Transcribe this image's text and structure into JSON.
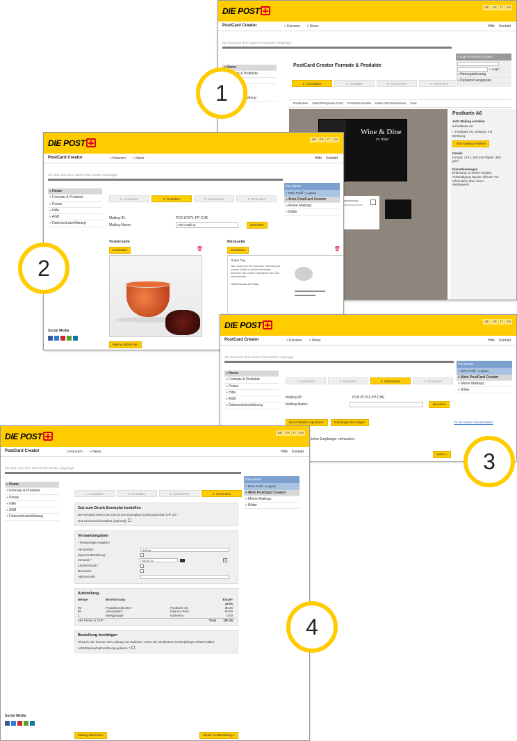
{
  "brand": {
    "logo_text": "DIE POST",
    "app_name": "PostCard Creator",
    "langs": [
      "DE",
      "FR",
      "IT",
      "EN"
    ]
  },
  "nav": {
    "konzern": "» Konzern",
    "news": "» News",
    "hilfe": "Hilfe",
    "kontakt": "Kontakt"
  },
  "badges": [
    "1",
    "2",
    "3",
    "4"
  ],
  "breadcrumb": "Sie sind unter dem Namen ihre Muster eingeloggt",
  "side": [
    "» Home",
    "» Formate & Produkte",
    "» Preise",
    "» Hilfe",
    "» AGB",
    "» Datenschutzerklärung"
  ],
  "steps": [
    "1. Auswählen",
    "2. Gestalten",
    "3. Adressieren",
    "4. Versenden"
  ],
  "right_panel": {
    "user": "Ihre Muster",
    "links": [
      "» Mein Profil",
      "» Logout"
    ],
    "items": [
      "» Mein PostCard Creator",
      "» Meine Mailings",
      "» Bilder"
    ]
  },
  "s1": {
    "title": "PostCard Creator Formate & Produkte",
    "login": "» Login PostCard Creator",
    "login_btn": "» Login",
    "reg": "» Neuregistrierung",
    "forgot": "» Passwort vergessen",
    "filters": [
      "Postkarten",
      "Direct/Response Card",
      "Postkarte Kreativ",
      "Karte mit Gutscheinen",
      "Fuer"
    ],
    "poster_title": "Wine & Dine",
    "poster_sub": "im Hotel",
    "side_item": "Postkartenbestellung",
    "product": "Postkarte A6",
    "create_head": "Jetzt Mailing erstellen",
    "opt1": "Postkarte A6",
    "opt2": "Postkarte A6, schwarz, mit Werbung",
    "btn": "Jetzt Mailing erstellen",
    "details_head": "Details",
    "details": "Format: 176 x 250 mm Papier: 300 g/m²",
    "extra_head": "Dienstleistungen",
    "extra": "Erfassung zu einem Kunden Ankündigung Tag der offenen Tür Information über einen Wettbewerb"
  },
  "s2": {
    "mailing_id_label": "Mailing-ID:",
    "mailing_id": "PCK-87271-PP-CHE",
    "mailing_name_label": "Mailing-Name:",
    "mailing_name": "Mein Mailing",
    "save": "speichern",
    "front": "Vorderseite",
    "back": "Rückseite",
    "edit": "bearbeiten",
    "greeting": "Guten Tag",
    "card_text": "Nur noch kurz ein bisschen Werbung für unsere Aktion vom Wochenende, kommen Sie vorbei und lassen Sie sich überraschen.",
    "card_sign": "Liebe Grüsse Ihr Team",
    "social": "Social Media",
    "cta": "Mailing abbrechen"
  },
  "s3": {
    "mailing_id": "PCK-87151-PP-CHE",
    "buttons": [
      "Excel-Tabelle importieren",
      "Empfänger hinzufügen"
    ],
    "link": "Zu ein Muster herunterladen",
    "empty": "keine Empfänger vorhanden.",
    "next": "weiter »"
  },
  "s4": {
    "sec1_title": "Gut zum Druck Exemplar bestellen",
    "sec1_text": "Der Versand eines Gut-zum-Druck-Exemplars kostet pauschal CHF 10.–",
    "sec1_check": "Gut zum Druck bestellen (optional):",
    "sec2_title": "Versandangaben",
    "required": "* Notwendige Angaben",
    "fields": [
      {
        "label": "Versandart:",
        "value": "A-Post"
      },
      {
        "label": "Express-Bestellung:",
        "value": ""
      },
      {
        "label": "Versand: *",
        "value": "06.05.13"
      },
      {
        "label": "Laufzeitzusatz:",
        "value": ""
      },
      {
        "label": "Druckzeit:",
        "value": ""
      },
      {
        "label": "Aktionscode:",
        "value": ""
      }
    ],
    "sec3_title": "Aufstellung",
    "cols": [
      "Menge",
      "Bezeichnung",
      "",
      "Einzel-preis"
    ],
    "rows": [
      [
        "90",
        "Produktionskosten",
        "Postkarte A6",
        "56.25"
      ],
      [
        "90",
        "Versandtarif",
        "Inland A-Post",
        "90.00"
      ],
      [
        "1",
        "Beleggruppe",
        "kostenlos",
        "0.00"
      ]
    ],
    "total_label": "Alle Preise in CHF",
    "total_word": "Total",
    "total": "187.25",
    "sec4_title": "Bestellung bestätigen",
    "sec4_text": "Hinweis: Sie können den Auftrag erst auslösen, wenn Sie mindestens 10 Empfänger erfasst haben.",
    "agb": "AGB/Datenschutzerklärung gelesen: *",
    "back": "Mailing abbrechen",
    "order": "Weiter zur Bestellung »",
    "social": "Social Media"
  }
}
